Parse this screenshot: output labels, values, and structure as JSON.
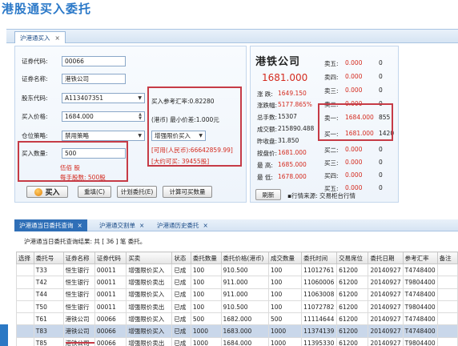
{
  "page_title": "港股通买入委托",
  "top_tab": {
    "label": "沪港通买入",
    "close": "×"
  },
  "order": {
    "code_label": "证券代码:",
    "code_value": "00066",
    "name_label": "证券名称:",
    "name_value": "港铁公司",
    "account_label": "股东代码:",
    "account_value": "A113407351",
    "price_label": "买入价格:",
    "price_value": "1684.000",
    "strategy_label": "仓位策略:",
    "strategy_value": "禁用策略",
    "qty_label": "买入数量:",
    "qty_value": "500",
    "qty_hint1": "伍佰 股",
    "qty_hint2": "每手股数: 500股"
  },
  "rate": {
    "ref_rate": "买入参考汇率:0.82280",
    "min_price": "(港币) 最小价差:1.000元",
    "order_type": "增强限价买入",
    "available": "[可用(人民币):66642859.99]",
    "can_buy": "[大约可买: 39455股]"
  },
  "buttons": {
    "buy": "买入",
    "reset": "重填(C)",
    "calc_order": "计划委托(E)",
    "calc_qty": "计算可买数量"
  },
  "quote": {
    "name": "港铁公司",
    "price": "1681.000",
    "rows": [
      {
        "k": "涨 跌:",
        "v": "1649.150"
      },
      {
        "k": "涨跌幅:",
        "v": "5177.865%"
      },
      {
        "k": "总手数:",
        "v": "15307"
      },
      {
        "k": "成交额:",
        "v": "215890.488"
      },
      {
        "k": "昨收盘:",
        "v": "31.850"
      },
      {
        "k": "按盘价:",
        "v": "1681.000"
      },
      {
        "k": "最  高:",
        "v": "1685.000"
      },
      {
        "k": "最  低:",
        "v": "1678.000"
      }
    ],
    "book": [
      {
        "k": "卖五:",
        "p": "0.000",
        "q": "0"
      },
      {
        "k": "卖四:",
        "p": "0.000",
        "q": "0"
      },
      {
        "k": "卖三:",
        "p": "0.000",
        "q": "0"
      },
      {
        "k": "卖二:",
        "p": "0.000",
        "q": "0"
      },
      {
        "k": "卖一:",
        "p": "1684.000",
        "q": "855"
      },
      {
        "k": "买一:",
        "p": "1681.000",
        "q": "1420"
      },
      {
        "k": "买二:",
        "p": "0.000",
        "q": "0"
      },
      {
        "k": "买三:",
        "p": "0.000",
        "q": "0"
      },
      {
        "k": "买四:",
        "p": "0.000",
        "q": "0"
      },
      {
        "k": "买五:",
        "p": "0.000",
        "q": "0"
      }
    ],
    "refresh": "刷新",
    "source": "▪行情来源: 交易柜台行情"
  },
  "bottom_tabs": [
    "沪港通当日委托查询",
    "沪港通交割单",
    "沪港通历史委托"
  ],
  "result_line": "沪港通当日委托查询结果: 共 [ 36 ] 笔 委托。",
  "table": {
    "headers": [
      "选择",
      "委托号",
      "证券名称",
      "证券代码",
      "买卖",
      "状态",
      "委托数量",
      "委托价格(港币)",
      "成交数量",
      "委托时间",
      "交易席位",
      "委托日期",
      "参考汇率",
      "备注"
    ],
    "rows": [
      [
        "",
        "T33",
        "恒生银行",
        "00011",
        "增强限价买入",
        "已成",
        "100",
        "910.500",
        "100",
        "11012761",
        "61200",
        "20140927",
        "T4748400",
        ""
      ],
      [
        "",
        "T42",
        "恒生银行",
        "00011",
        "增强限价卖出",
        "已成",
        "100",
        "911.000",
        "100",
        "11060006",
        "61200",
        "20140927",
        "T9804400",
        ""
      ],
      [
        "",
        "T44",
        "恒生银行",
        "00011",
        "增强限价买入",
        "已成",
        "100",
        "911.000",
        "100",
        "11063008",
        "61200",
        "20140927",
        "T4748400",
        ""
      ],
      [
        "",
        "T50",
        "恒生银行",
        "00011",
        "增强限价卖出",
        "已成",
        "100",
        "910.500",
        "100",
        "11072782",
        "61200",
        "20140927",
        "T9804400",
        ""
      ],
      [
        "",
        "T61",
        "港铁公司",
        "00066",
        "增强限价买入",
        "已成",
        "500",
        "1682.000",
        "500",
        "11114644",
        "61200",
        "20140927",
        "T4748400",
        ""
      ],
      [
        "",
        "T83",
        "港铁公司",
        "00066",
        "增强限价买入",
        "已成",
        "1000",
        "1683.000",
        "1000",
        "11374139",
        "61200",
        "20140927",
        "T4748400",
        ""
      ],
      [
        "",
        "T85",
        "港铁公司",
        "00066",
        "增强限价卖出",
        "已成",
        "1000",
        "1684.000",
        "1000",
        "11395330",
        "61200",
        "20140927",
        "T9804400",
        ""
      ]
    ]
  }
}
